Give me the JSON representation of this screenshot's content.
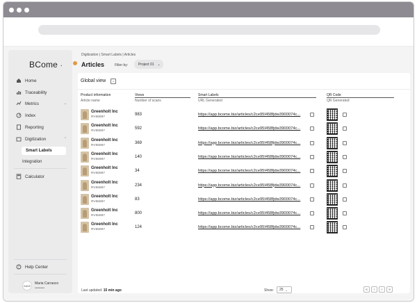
{
  "sidebar": {
    "logo": "BCome",
    "logo_dot": "·",
    "items": [
      {
        "label": "Home",
        "icon": "home-icon"
      },
      {
        "label": "Traceability",
        "icon": "chart-bars-icon"
      },
      {
        "label": "Metrics",
        "icon": "trend-line-icon"
      },
      {
        "label": "Index",
        "icon": "gauge-icon"
      },
      {
        "label": "Reporting",
        "icon": "document-icon"
      },
      {
        "label": "Digitization",
        "icon": "folder-icon"
      }
    ],
    "sub_items": [
      {
        "label": "Smart Labels",
        "active": true
      },
      {
        "label": "Integration",
        "active": false
      }
    ],
    "calculator": "Calculator",
    "help": "Help Center",
    "user": {
      "initials": "SAVE",
      "name": "Maria Carrasco",
      "password": "••••••••"
    }
  },
  "main": {
    "breadcrumb": "Digitization | Smart Labels | Articles",
    "title": "Articles",
    "filter_label": "Filter by:",
    "filter_value": "Project 01",
    "global_view": "Global view",
    "columns": {
      "product_info": "Product information",
      "article_name": "Article name",
      "views": "Views",
      "num_scans": "Number of scans",
      "smart_labels": "Smart Labels",
      "url_generated": "URL Generated",
      "qr_code": "QR Code",
      "qr_generated": "QR Generated"
    },
    "rows": [
      {
        "name": "Greenholt Inc",
        "code": "RV65987",
        "views": "983",
        "url": "https://app.bcome.biz/articles/c2ce95I458fjdw3900074c..."
      },
      {
        "name": "Greenholt Inc",
        "code": "RV65987",
        "views": "592",
        "url": "https://app.bcome.biz/articles/c2ce95I458fjdw3900074c..."
      },
      {
        "name": "Greenholt Inc",
        "code": "RV65987",
        "views": "369",
        "url": "https://app.bcome.biz/articles/c2ce95I458fjdw3900074c..."
      },
      {
        "name": "Greenholt Inc",
        "code": "RV65987",
        "views": "140",
        "url": "https://app.bcome.biz/articles/c2ce95I458fjdw3900074c..."
      },
      {
        "name": "Greenholt Inc",
        "code": "RV65987",
        "views": "34",
        "url": "https://app.bcome.biz/articles/c2ce95I458fjdw3900074c..."
      },
      {
        "name": "Greenholt Inc",
        "code": "RV65987",
        "views": "234",
        "url": "https://app.bcome.biz/articles/c2ce95I458fjdw3900074c..."
      },
      {
        "name": "Greenholt Inc",
        "code": "RV65987",
        "views": "83",
        "url": "https://app.bcome.biz/articles/c2ce95I458fjdw3900074c..."
      },
      {
        "name": "Greenholt Inc",
        "code": "RV65987",
        "views": "800",
        "url": "https://app.bcome.biz/articles/c2ce95I458fjdw3900074c..."
      },
      {
        "name": "Greenholt Inc",
        "code": "RV65987",
        "views": "124",
        "url": "https://app.bcome.biz/articles/c2ce95I458fjdw3900074c..."
      }
    ],
    "footer": {
      "last_updated_label": "Last updated:",
      "last_updated_value": "15 min ago",
      "show_label": "Show:",
      "show_value": "25",
      "pager": [
        "«",
        "‹",
        "›",
        "»"
      ]
    }
  },
  "colors": {
    "accent_badge": "#e09a43",
    "sidebar_bg": "#ebebec",
    "titlebar": "#8e8b93"
  }
}
